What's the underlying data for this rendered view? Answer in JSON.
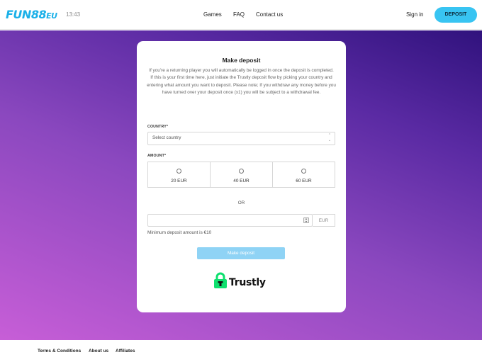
{
  "header": {
    "logo_text": "FUN88",
    "logo_suffix": "EU",
    "time": "13:43",
    "nav": [
      "Games",
      "FAQ",
      "Contact us"
    ],
    "signin_label": "Sign in",
    "deposit_label": "DEPOSIT"
  },
  "colors": {
    "brand": "#1ab0e8",
    "deposit_button": "#38c4f2",
    "submit_button": "#8fd3f5",
    "trustly_green": "#0ee06e",
    "hero_gradient": [
      "#c75ed7",
      "#8b48bf",
      "#5a2aa3",
      "#30127d"
    ]
  },
  "card": {
    "title": "Make deposit",
    "intro_1": "If you're a returning player you will automatically be logged in once the deposit is completed.",
    "intro_2": "If this is your first time here, just initiate the Trustly deposit flow by picking your country and entering what amount you want to deposit. Please note; If you withdraw any money before you have turned over your deposit once (x1) you will be subject to a withdrawal fee.",
    "country_label": "COUNTRY*",
    "country_placeholder": "Select country",
    "amount_label": "AMOUNT*",
    "amount_options": [
      "20 EUR",
      "40 EUR",
      "60 EUR"
    ],
    "or_text": "OR",
    "custom_amount_value": "",
    "currency": "EUR",
    "min_note": "Minimum deposit amount is €10",
    "submit_label": "Make deposit",
    "trustly_logo": "Trustly"
  },
  "footer": {
    "links": [
      "Terms & Conditions",
      "About us",
      "Affiliates"
    ]
  },
  "icons": [
    "select-arrows-icon",
    "radio-icon",
    "number-stepper-icon",
    "trustly-lock-icon"
  ]
}
